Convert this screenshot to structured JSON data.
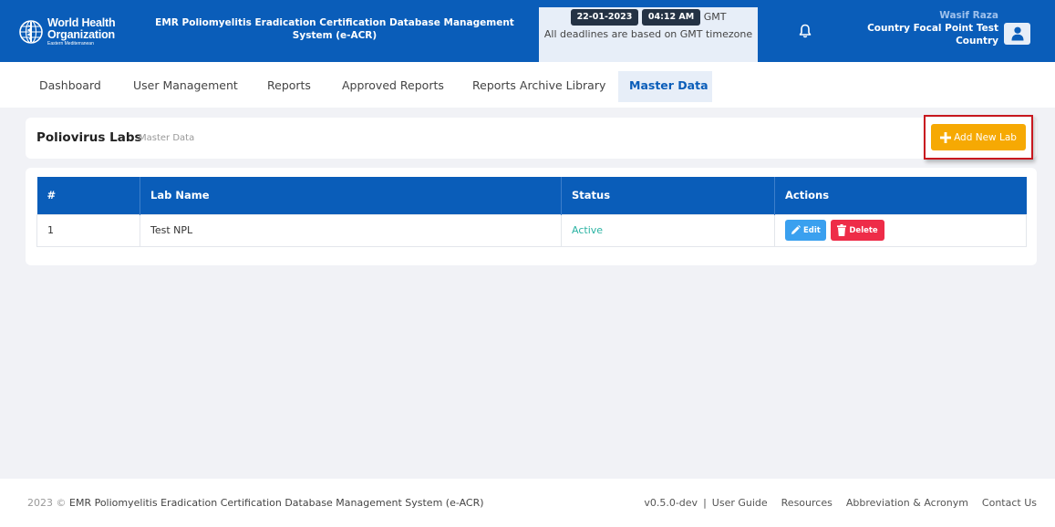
{
  "header": {
    "logo": {
      "line1": "World Health",
      "line2": "Organization",
      "line3": "Eastern Mediterranean"
    },
    "app_title": "EMR Poliomyelitis Eradication Certification Database Management System (e-ACR)",
    "date": "22-01-2023",
    "time": "04:12 AM",
    "tz": "GMT",
    "deadline_note": "All deadlines are based on GMT timezone",
    "user": {
      "name": "Wasif Raza",
      "role": "Country Focal Point Test",
      "role2": "Country"
    }
  },
  "nav": {
    "items": [
      {
        "label": "Dashboard"
      },
      {
        "label": "User Management"
      },
      {
        "label": "Reports"
      },
      {
        "label": "Approved Reports"
      },
      {
        "label": "Reports Archive Library"
      },
      {
        "label": "Master Data"
      }
    ],
    "active": "Master Data"
  },
  "page": {
    "title": "Poliovirus Labs",
    "subtitle": "Master Data",
    "add_button": "Add New Lab"
  },
  "table": {
    "headers": [
      "#",
      "Lab Name",
      "Status",
      "Actions"
    ],
    "rows": [
      {
        "num": "1",
        "name": "Test NPL",
        "status": "Active"
      }
    ],
    "edit_label": "Edit",
    "delete_label": "Delete"
  },
  "footer": {
    "copyright_year": "2023 ©",
    "copyright_text": "EMR Poliomyelitis Eradication Certification Database Management System (e-ACR)",
    "version": "v0.5.0-dev",
    "separator": "|",
    "links": [
      "User Guide",
      "Resources",
      "Abbreviation & Acronym",
      "Contact Us"
    ]
  },
  "colors": {
    "primary": "#0a5db9",
    "accent": "#f6a903",
    "status_active": "#2bb3a3",
    "edit": "#3aa0ef",
    "delete": "#ee2c48",
    "highlight": "#c8181f"
  },
  "icons": [
    "who-logo-icon",
    "bell-icon",
    "user-icon",
    "plus-icon",
    "pencil-icon",
    "trash-icon"
  ]
}
